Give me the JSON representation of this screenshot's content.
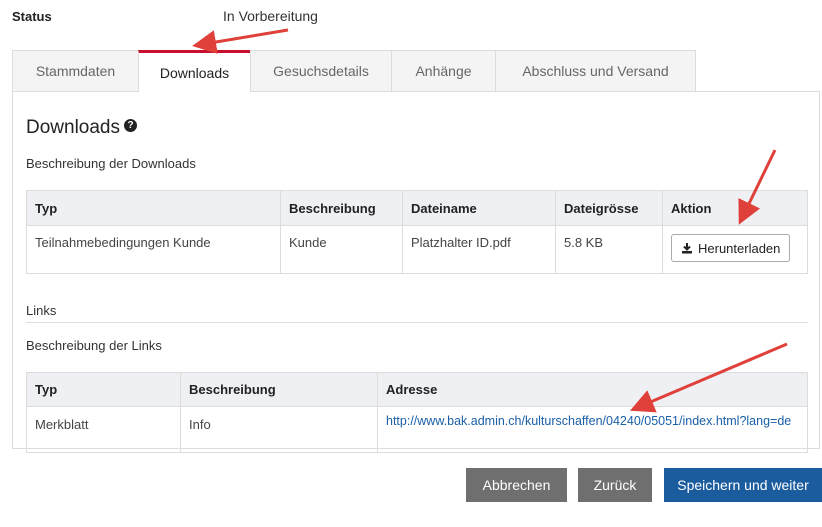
{
  "status": {
    "label": "Status",
    "value": "In Vorbereitung"
  },
  "tabs": [
    {
      "label": "Stammdaten",
      "active": false
    },
    {
      "label": "Downloads",
      "active": true
    },
    {
      "label": "Gesuchsdetails",
      "active": false
    },
    {
      "label": "Anhänge",
      "active": false
    },
    {
      "label": "Abschluss und Versand",
      "active": false
    }
  ],
  "downloads": {
    "title": "Downloads",
    "help_icon": "question-circle-icon",
    "description": "Beschreibung der Downloads",
    "columns": [
      "Typ",
      "Beschreibung",
      "Dateiname",
      "Dateigrösse",
      "Aktion"
    ],
    "rows": [
      {
        "typ": "Teilnahmebedingungen Kunde",
        "beschreibung": "Kunde",
        "dateiname": "Platzhalter ID.pdf",
        "dateigroesse": "5.8 KB",
        "aktion": "Herunterladen"
      }
    ]
  },
  "links": {
    "title": "Links",
    "description": "Beschreibung der Links",
    "columns": [
      "Typ",
      "Beschreibung",
      "Adresse"
    ],
    "rows": [
      {
        "typ": "Merkblatt",
        "beschreibung": "Info",
        "adresse": "http://www.bak.admin.ch/kulturschaffen/04240/05051/index.html?lang=de"
      }
    ]
  },
  "footer": {
    "cancel": "Abbrechen",
    "back": "Zurück",
    "save_next": "Speichern und weiter"
  },
  "colors": {
    "tab_active_border": "#c8102e",
    "primary_button": "#1b5c9e",
    "secondary_button": "#6f6f6f",
    "link": "#1a5fa8",
    "annotation_arrow": "#e0403a"
  }
}
